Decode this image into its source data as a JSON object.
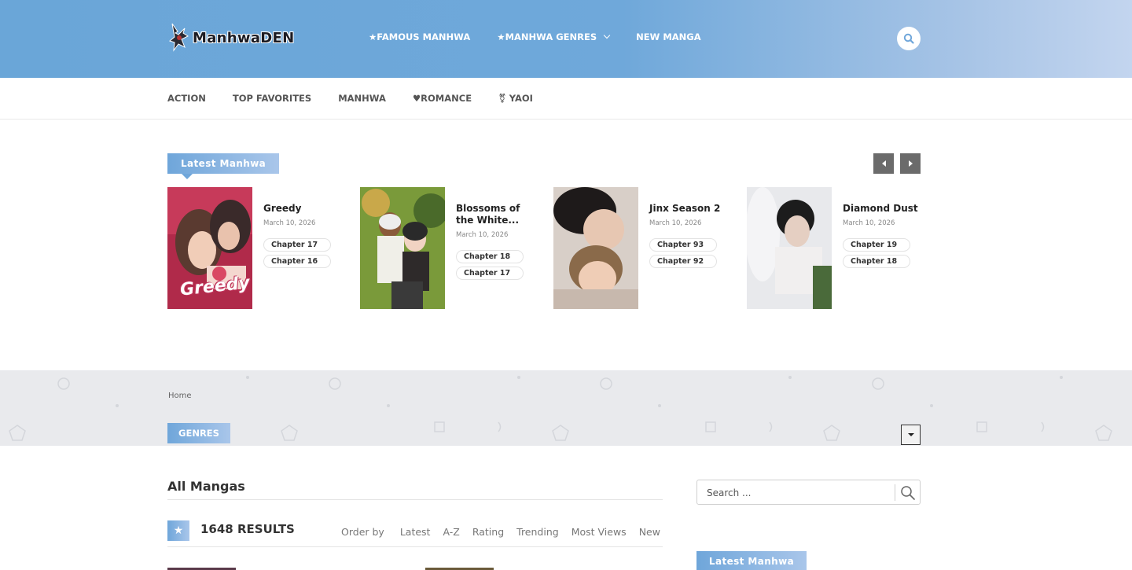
{
  "header": {
    "logo_text": "ManhwaDEN",
    "nav": [
      {
        "label": "★FAMOUS MANHWA",
        "has_dropdown": false
      },
      {
        "label": "★MANHWA GENRES",
        "has_dropdown": true
      },
      {
        "label": "NEW MANGA",
        "has_dropdown": false
      }
    ],
    "search_icon": "search-icon"
  },
  "subnav": [
    "ACTION",
    "TOP FAVORITES",
    "MANHWA",
    "♥ROMANCE",
    "⚧ YAOI"
  ],
  "latest": {
    "heading": "Latest Manhwa",
    "cards": [
      {
        "title": "Greedy",
        "date": "March 10, 2026",
        "chapters": [
          "Chapter 17",
          "Chapter 16"
        ],
        "cover_text": "Greedy"
      },
      {
        "title": "Blossoms of the White...",
        "date": "March 10, 2026",
        "chapters": [
          "Chapter 18",
          "Chapter 17"
        ]
      },
      {
        "title": "Jinx Season 2",
        "date": "March 10, 2026",
        "chapters": [
          "Chapter 93",
          "Chapter 92"
        ]
      },
      {
        "title": "Diamond Dust",
        "date": "March 10, 2026",
        "chapters": [
          "Chapter 19",
          "Chapter 18"
        ]
      }
    ]
  },
  "breadcrumb": "Home",
  "genres_label": "GENRES",
  "main": {
    "title": "All Mangas",
    "results": "1648 RESULTS",
    "order_label": "Order by",
    "order_options": [
      "Latest",
      "A-Z",
      "Rating",
      "Trending",
      "Most Views",
      "New"
    ]
  },
  "sidebar": {
    "search_placeholder": "Search ...",
    "latest_heading": "Latest Manhwa"
  },
  "colors": {
    "accent": "#6fa6da",
    "accent_light": "#a9c6ea",
    "band": "#e9eaed"
  }
}
